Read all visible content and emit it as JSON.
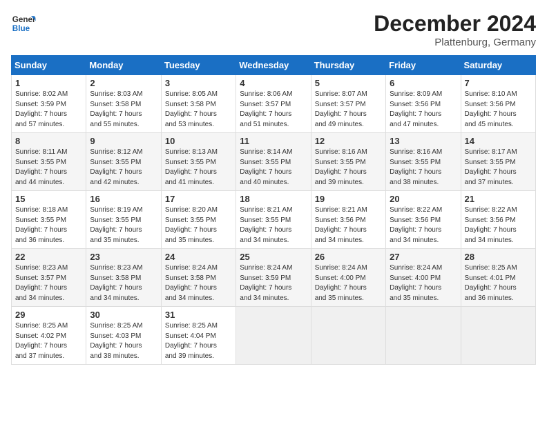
{
  "header": {
    "logo_line1": "General",
    "logo_line2": "Blue",
    "month": "December 2024",
    "location": "Plattenburg, Germany"
  },
  "days_of_week": [
    "Sunday",
    "Monday",
    "Tuesday",
    "Wednesday",
    "Thursday",
    "Friday",
    "Saturday"
  ],
  "weeks": [
    [
      {
        "day": "1",
        "sunrise": "8:02 AM",
        "sunset": "3:59 PM",
        "daylight": "7 hours and 57 minutes."
      },
      {
        "day": "2",
        "sunrise": "8:03 AM",
        "sunset": "3:58 PM",
        "daylight": "7 hours and 55 minutes."
      },
      {
        "day": "3",
        "sunrise": "8:05 AM",
        "sunset": "3:58 PM",
        "daylight": "7 hours and 53 minutes."
      },
      {
        "day": "4",
        "sunrise": "8:06 AM",
        "sunset": "3:57 PM",
        "daylight": "7 hours and 51 minutes."
      },
      {
        "day": "5",
        "sunrise": "8:07 AM",
        "sunset": "3:57 PM",
        "daylight": "7 hours and 49 minutes."
      },
      {
        "day": "6",
        "sunrise": "8:09 AM",
        "sunset": "3:56 PM",
        "daylight": "7 hours and 47 minutes."
      },
      {
        "day": "7",
        "sunrise": "8:10 AM",
        "sunset": "3:56 PM",
        "daylight": "7 hours and 45 minutes."
      }
    ],
    [
      {
        "day": "8",
        "sunrise": "8:11 AM",
        "sunset": "3:55 PM",
        "daylight": "7 hours and 44 minutes."
      },
      {
        "day": "9",
        "sunrise": "8:12 AM",
        "sunset": "3:55 PM",
        "daylight": "7 hours and 42 minutes."
      },
      {
        "day": "10",
        "sunrise": "8:13 AM",
        "sunset": "3:55 PM",
        "daylight": "7 hours and 41 minutes."
      },
      {
        "day": "11",
        "sunrise": "8:14 AM",
        "sunset": "3:55 PM",
        "daylight": "7 hours and 40 minutes."
      },
      {
        "day": "12",
        "sunrise": "8:16 AM",
        "sunset": "3:55 PM",
        "daylight": "7 hours and 39 minutes."
      },
      {
        "day": "13",
        "sunrise": "8:16 AM",
        "sunset": "3:55 PM",
        "daylight": "7 hours and 38 minutes."
      },
      {
        "day": "14",
        "sunrise": "8:17 AM",
        "sunset": "3:55 PM",
        "daylight": "7 hours and 37 minutes."
      }
    ],
    [
      {
        "day": "15",
        "sunrise": "8:18 AM",
        "sunset": "3:55 PM",
        "daylight": "7 hours and 36 minutes."
      },
      {
        "day": "16",
        "sunrise": "8:19 AM",
        "sunset": "3:55 PM",
        "daylight": "7 hours and 35 minutes."
      },
      {
        "day": "17",
        "sunrise": "8:20 AM",
        "sunset": "3:55 PM",
        "daylight": "7 hours and 35 minutes."
      },
      {
        "day": "18",
        "sunrise": "8:21 AM",
        "sunset": "3:55 PM",
        "daylight": "7 hours and 34 minutes."
      },
      {
        "day": "19",
        "sunrise": "8:21 AM",
        "sunset": "3:56 PM",
        "daylight": "7 hours and 34 minutes."
      },
      {
        "day": "20",
        "sunrise": "8:22 AM",
        "sunset": "3:56 PM",
        "daylight": "7 hours and 34 minutes."
      },
      {
        "day": "21",
        "sunrise": "8:22 AM",
        "sunset": "3:56 PM",
        "daylight": "7 hours and 34 minutes."
      }
    ],
    [
      {
        "day": "22",
        "sunrise": "8:23 AM",
        "sunset": "3:57 PM",
        "daylight": "7 hours and 34 minutes."
      },
      {
        "day": "23",
        "sunrise": "8:23 AM",
        "sunset": "3:58 PM",
        "daylight": "7 hours and 34 minutes."
      },
      {
        "day": "24",
        "sunrise": "8:24 AM",
        "sunset": "3:58 PM",
        "daylight": "7 hours and 34 minutes."
      },
      {
        "day": "25",
        "sunrise": "8:24 AM",
        "sunset": "3:59 PM",
        "daylight": "7 hours and 34 minutes."
      },
      {
        "day": "26",
        "sunrise": "8:24 AM",
        "sunset": "4:00 PM",
        "daylight": "7 hours and 35 minutes."
      },
      {
        "day": "27",
        "sunrise": "8:24 AM",
        "sunset": "4:00 PM",
        "daylight": "7 hours and 35 minutes."
      },
      {
        "day": "28",
        "sunrise": "8:25 AM",
        "sunset": "4:01 PM",
        "daylight": "7 hours and 36 minutes."
      }
    ],
    [
      {
        "day": "29",
        "sunrise": "8:25 AM",
        "sunset": "4:02 PM",
        "daylight": "7 hours and 37 minutes."
      },
      {
        "day": "30",
        "sunrise": "8:25 AM",
        "sunset": "4:03 PM",
        "daylight": "7 hours and 38 minutes."
      },
      {
        "day": "31",
        "sunrise": "8:25 AM",
        "sunset": "4:04 PM",
        "daylight": "7 hours and 39 minutes."
      },
      null,
      null,
      null,
      null
    ]
  ]
}
